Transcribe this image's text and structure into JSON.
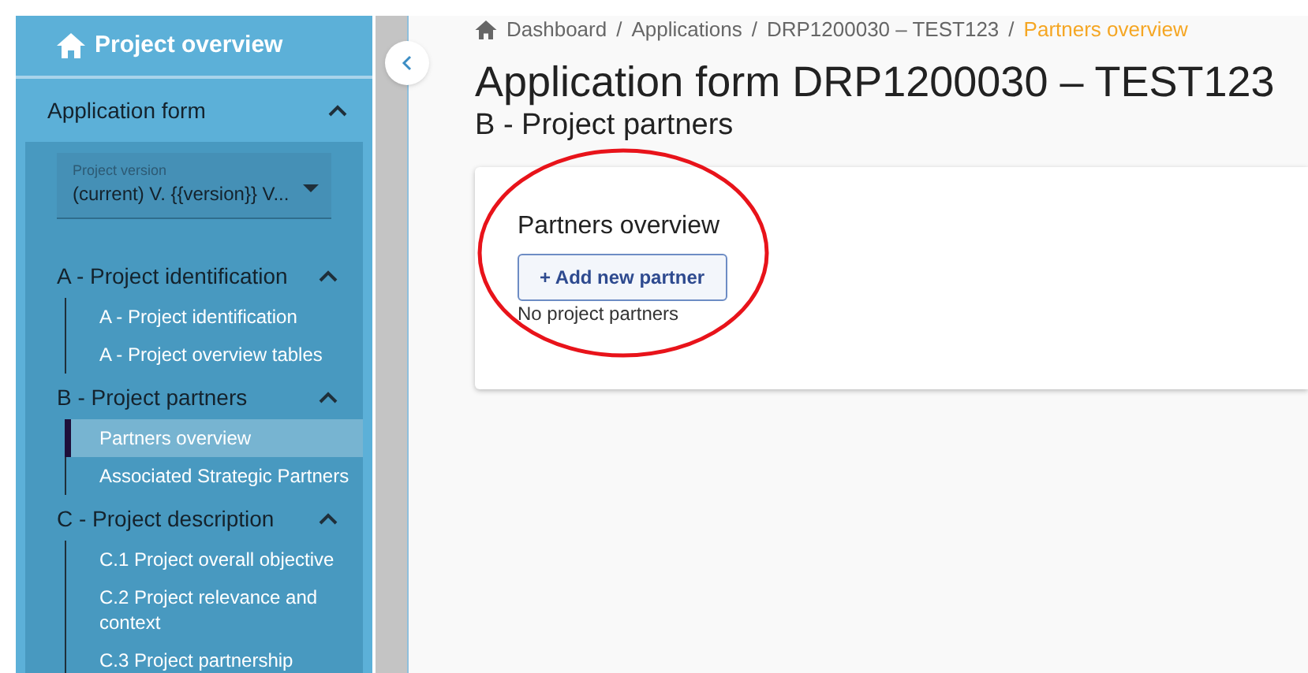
{
  "sidebar": {
    "overview_link": "Project overview",
    "section": {
      "title": "Application form",
      "expanded": true,
      "version_select": {
        "label": "Project version",
        "value": "(current) V. {{version}} V..."
      },
      "groups": [
        {
          "title": "A - Project identification",
          "expanded": true,
          "items": [
            {
              "label": "A - Project identification",
              "selected": false
            },
            {
              "label": "A - Project overview tables",
              "selected": false
            }
          ]
        },
        {
          "title": "B - Project partners",
          "expanded": true,
          "items": [
            {
              "label": "Partners overview",
              "selected": true
            },
            {
              "label": "Associated Strategic Partners",
              "selected": false
            }
          ]
        },
        {
          "title": "C - Project description",
          "expanded": true,
          "items": [
            {
              "label": "C.1 Project overall objective",
              "selected": false
            },
            {
              "label": "C.2 Project relevance and context",
              "selected": false
            },
            {
              "label": "C.3 Project partnership",
              "selected": false
            }
          ]
        }
      ]
    }
  },
  "breadcrumb": [
    {
      "label": "Dashboard",
      "current": false
    },
    {
      "separator": "/",
      "label": "Applications",
      "current": false
    },
    {
      "separator": "/",
      "label": "DRP1200030 – TEST123",
      "current": false
    },
    {
      "separator": "/",
      "label": "Partners overview",
      "current": true
    }
  ],
  "title": "Application form DRP1200030 – TEST123",
  "subtitle": "B - Project partners",
  "card": {
    "heading": "Partners overview",
    "add_button": "+ Add new partner",
    "empty_text": "No project partners"
  }
}
